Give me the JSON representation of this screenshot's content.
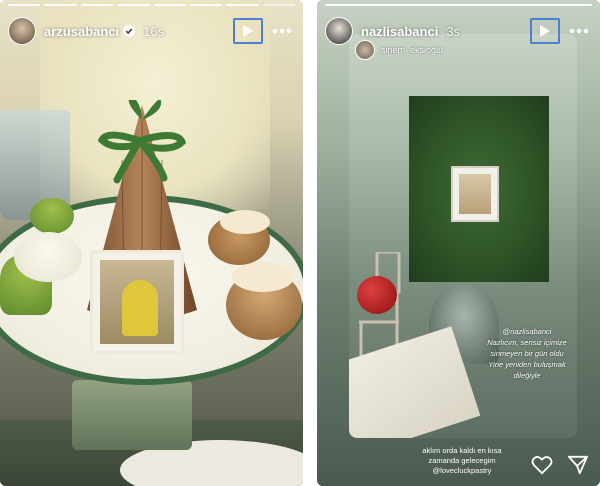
{
  "left_story": {
    "username": "arzusabanci",
    "timestamp": "16s",
    "segments_total": 8,
    "segments_done": 7
  },
  "right_story": {
    "username": "nazlisabanci",
    "timestamp": "3s",
    "creator_tag": "sinem_eksioglu",
    "caption": {
      "mention": "@nazlisabanci",
      "lines": [
        "Nazlıcım, sensiz içimize",
        "sinmeyen bir gün oldu",
        "Yine yeniden buluşmak",
        "dileğiyle"
      ]
    },
    "bottom_text": {
      "line1": "aklım orda kaldı en kısa",
      "line2": "zamanda gelecegim",
      "line3": "@lovecluckpastry"
    }
  },
  "icons": {
    "play": "play-icon",
    "more": "more-icon",
    "verified": "verified-badge-icon",
    "heart": "heart-icon",
    "send": "send-icon"
  },
  "colors": {
    "highlight_border": "#4e7fd1",
    "verified_blue": "#3897f0"
  }
}
